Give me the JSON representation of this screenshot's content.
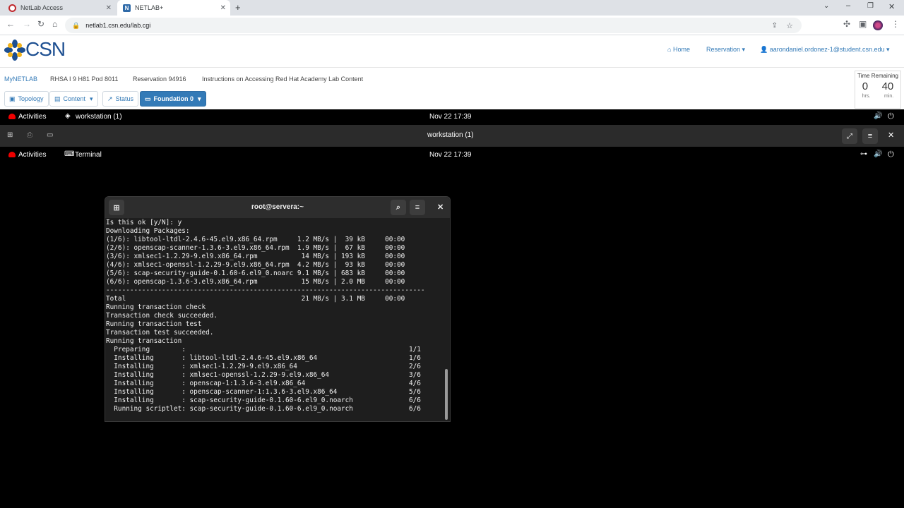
{
  "browser": {
    "tabs": [
      {
        "title": "NetLab Access",
        "icon": "netlab-circle-icon"
      },
      {
        "title": "NETLAB+",
        "icon": "netlab-n-icon"
      }
    ],
    "url": "netlab1.csn.edu/lab.cgi"
  },
  "header": {
    "logo_text": "CSN",
    "home_label": "Home",
    "reservation_label": "Reservation",
    "user_label": "aarondaniel.ordonez-1@student.csn.edu"
  },
  "breadcrumb": [
    "MyNETLAB",
    "RHSA I 9 H81 Pod 8011",
    "Reservation 94916",
    "Instructions on Accessing Red Hat Academy Lab Content"
  ],
  "toolbar": {
    "topology": "Topology",
    "content": "Content",
    "status": "Status",
    "foundation": "Foundation 0"
  },
  "time_remaining": {
    "title": "Time Remaining",
    "hours": "0",
    "minutes": "40",
    "hours_unit": "hrs.",
    "minutes_unit": "min."
  },
  "outer_gnome": {
    "activities": "Activities",
    "app": "workstation (1)",
    "clock": "Nov 22  17:39"
  },
  "vm_window": {
    "title": "workstation (1)"
  },
  "inner_gnome": {
    "activities": "Activities",
    "app": "Terminal",
    "clock": "Nov 22  17:39"
  },
  "terminal": {
    "title": "root@servera:~",
    "lines": [
      "Is this ok [y/N]: y",
      "Downloading Packages:",
      "(1/6): libtool-ltdl-2.4.6-45.el9.x86_64.rpm     1.2 MB/s |  39 kB     00:00",
      "(2/6): openscap-scanner-1.3.6-3.el9.x86_64.rpm  1.9 MB/s |  67 kB     00:00",
      "(3/6): xmlsec1-1.2.29-9.el9.x86_64.rpm           14 MB/s | 193 kB     00:00",
      "(4/6): xmlsec1-openssl-1.2.29-9.el9.x86_64.rpm  4.2 MB/s |  93 kB     00:00",
      "(5/6): scap-security-guide-0.1.60-6.el9_0.noarc 9.1 MB/s | 683 kB     00:00",
      "(6/6): openscap-1.3.6-3.el9.x86_64.rpm           15 MB/s | 2.0 MB     00:00",
      "--------------------------------------------------------------------------------",
      "Total                                            21 MB/s | 3.1 MB     00:00",
      "Running transaction check",
      "Transaction check succeeded.",
      "Running transaction test",
      "Transaction test succeeded.",
      "Running transaction",
      "  Preparing        :                                                        1/1",
      "  Installing       : libtool-ltdl-2.4.6-45.el9.x86_64                       1/6",
      "  Installing       : xmlsec1-1.2.29-9.el9.x86_64                            2/6",
      "  Installing       : xmlsec1-openssl-1.2.29-9.el9.x86_64                    3/6",
      "  Installing       : openscap-1:1.3.6-3.el9.x86_64                          4/6",
      "  Installing       : openscap-scanner-1:1.3.6-3.el9.x86_64                  5/6",
      "  Installing       : scap-security-guide-0.1.60-6.el9_0.noarch              6/6",
      "  Running scriptlet: scap-security-guide-0.1.60-6.el9_0.noarch              6/6"
    ]
  },
  "colors": {
    "netlab_blue": "#337ab7",
    "redhat_red": "#ee0000",
    "terminal_bg": "#1e1e1e"
  }
}
